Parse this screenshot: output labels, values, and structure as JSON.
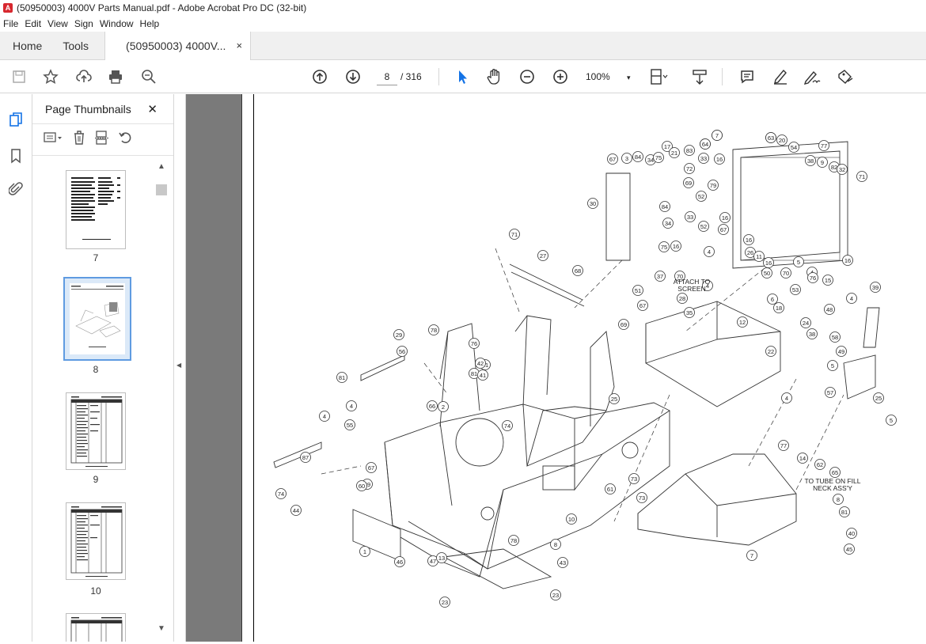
{
  "window": {
    "title": "(50950003) 4000V Parts Manual.pdf - Adobe Acrobat Pro DC (32-bit)"
  },
  "menu": [
    "File",
    "Edit",
    "View",
    "Sign",
    "Window",
    "Help"
  ],
  "tabs": {
    "home": "Home",
    "tools": "Tools",
    "doc": "(50950003) 4000V...",
    "close": "×"
  },
  "toolbar": {
    "page": "8",
    "page_count": "/ 316",
    "zoom": "100%"
  },
  "panel": {
    "title": "Page Thumbnails",
    "close": "✕"
  },
  "thumbnails": [
    "7",
    "8",
    "9",
    "10"
  ],
  "drawing": {
    "callouts": [
      "79",
      "28",
      "19",
      "20",
      "54",
      "77",
      "38",
      "9",
      "82",
      "32",
      "71",
      "67",
      "3",
      "84",
      "34",
      "75",
      "17",
      "21",
      "83",
      "33",
      "16",
      "72",
      "69",
      "79",
      "52",
      "30",
      "84",
      "33",
      "52",
      "16",
      "67",
      "34",
      "75",
      "16",
      "26",
      "11",
      "16",
      "5",
      "16",
      "71",
      "27",
      "16",
      "4",
      "70",
      "51",
      "68",
      "37",
      "35",
      "4",
      "50",
      "70",
      "4",
      "15",
      "39",
      "67",
      "28",
      "6",
      "18",
      "53",
      "76",
      "4",
      "24",
      "48",
      "12",
      "69",
      "22",
      "38",
      "58",
      "49",
      "78",
      "76",
      "29",
      "56",
      "31",
      "81",
      "41",
      "5",
      "81",
      "4",
      "4",
      "2",
      "42",
      "66",
      "74",
      "25",
      "4",
      "57",
      "25",
      "5",
      "87",
      "55",
      "77",
      "67",
      "14",
      "74",
      "62",
      "59",
      "73",
      "65",
      "44",
      "60",
      "61",
      "73",
      "8",
      "81",
      "40",
      "45",
      "1",
      "46",
      "47",
      "78",
      "10",
      "8",
      "13",
      "43",
      "23",
      "23",
      "7",
      "7",
      "64",
      "63"
    ],
    "notes": [
      "ATTACH TO\nSCREEN",
      "TO TUBE ON FILL\nNECK ASS'Y"
    ]
  }
}
